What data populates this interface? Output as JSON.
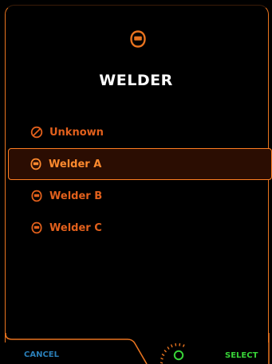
{
  "header": {
    "title": "WELDER",
    "icon": "welding-helmet-icon"
  },
  "list": {
    "items": [
      {
        "label": "Unknown",
        "icon": "prohibited-circle-icon",
        "selected": false
      },
      {
        "label": "Welder A",
        "icon": "welding-helmet-icon",
        "selected": true
      },
      {
        "label": "Welder B",
        "icon": "welding-helmet-icon",
        "selected": false
      },
      {
        "label": "Welder C",
        "icon": "welding-helmet-icon",
        "selected": false
      }
    ]
  },
  "footer": {
    "cancel_label": "CANCEL",
    "select_label": "SELECT",
    "knob_icon": "rotary-knob-icon"
  },
  "colors": {
    "accent": "#e8731f",
    "item_text": "#e2601c",
    "selected_bg": "#2b0d02",
    "cancel": "#2a7fb8",
    "select": "#38d438"
  }
}
